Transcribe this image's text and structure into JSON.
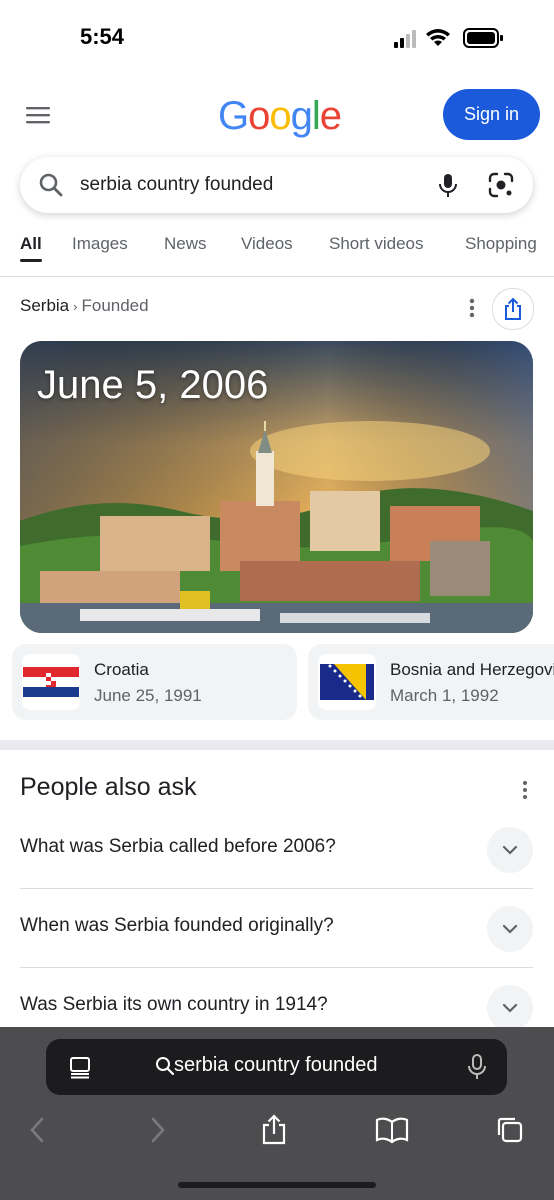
{
  "status": {
    "time": "5:54"
  },
  "header": {
    "logo_letters": [
      {
        "ch": "G",
        "color": "#4285F4"
      },
      {
        "ch": "o",
        "color": "#EA4335"
      },
      {
        "ch": "o",
        "color": "#FBBC05"
      },
      {
        "ch": "g",
        "color": "#4285F4"
      },
      {
        "ch": "l",
        "color": "#34A853"
      },
      {
        "ch": "e",
        "color": "#EA4335"
      }
    ],
    "sign_in_label": "Sign in"
  },
  "search": {
    "query": "serbia country founded"
  },
  "tabs": [
    {
      "label": "All"
    },
    {
      "label": "Images"
    },
    {
      "label": "News"
    },
    {
      "label": "Videos"
    },
    {
      "label": "Short videos"
    },
    {
      "label": "Shopping"
    }
  ],
  "breadcrumb": {
    "entity": "Serbia",
    "separator": "›",
    "attribute": "Founded"
  },
  "answer": {
    "date": "June 5, 2006"
  },
  "related": [
    {
      "name": "Croatia",
      "date": "June 25, 1991",
      "flag": "croatia-flag-icon"
    },
    {
      "name": "Bosnia and Herzegovina",
      "date": "March 1, 1992",
      "flag": "bosnia-flag-icon"
    }
  ],
  "people_also_ask": {
    "title": "People also ask",
    "questions": [
      "What was Serbia called before 2006?",
      "When was Serbia founded originally?",
      "Was Serbia its own country in 1914?"
    ]
  },
  "browser": {
    "address_text": "serbia country founded"
  },
  "colors": {
    "accent": "#1a5adb",
    "text": "#202124",
    "muted": "#5f6368"
  }
}
